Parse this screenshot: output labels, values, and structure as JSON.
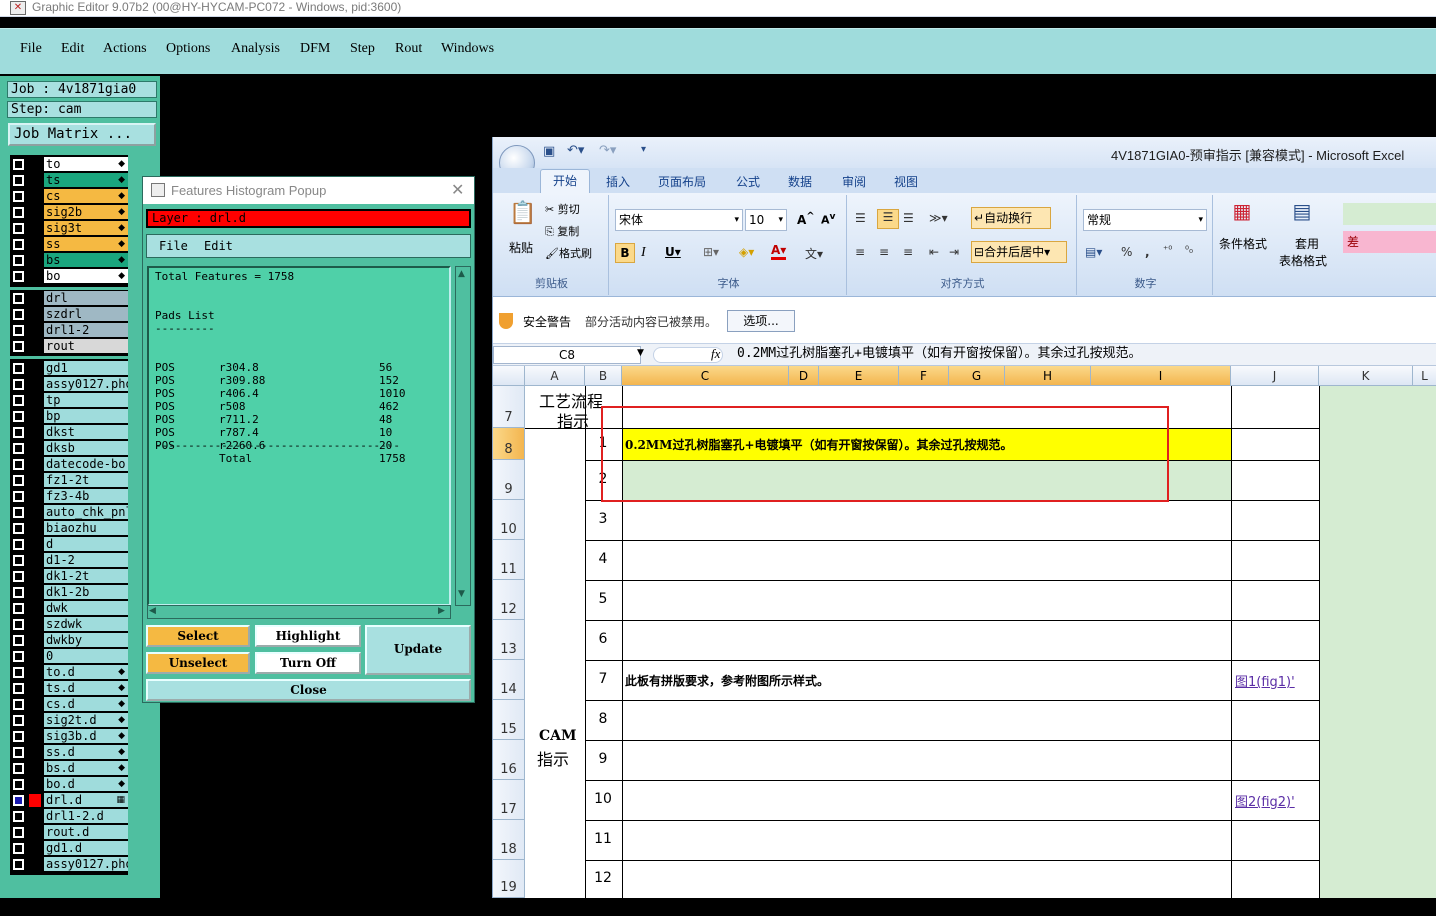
{
  "window": {
    "title": "Graphic Editor 9.07b2 (00@HY-HYCAM-PC072 - Windows, pid:3600)"
  },
  "menu": [
    {
      "label": "File"
    },
    {
      "label": "Edit"
    },
    {
      "label": "Actions"
    },
    {
      "label": "Options"
    },
    {
      "label": "Analysis"
    },
    {
      "label": "DFM"
    },
    {
      "label": "Step"
    },
    {
      "label": "Rout"
    },
    {
      "label": "Windows"
    }
  ],
  "job": {
    "job_label": "Job : 4v1871gia0",
    "step_label": "Step: cam",
    "matrix_button": "Job Matrix ..."
  },
  "layers": [
    {
      "name": "to",
      "color": "#ffffff",
      "mark": "◆"
    },
    {
      "name": "ts",
      "color": "#1aa67e",
      "mark": "◆"
    },
    {
      "name": "cs",
      "color": "#f5b942",
      "mark": "◆"
    },
    {
      "name": "sig2b",
      "color": "#f5b942",
      "mark": "◆"
    },
    {
      "name": "sig3t",
      "color": "#f5b942",
      "mark": "◆"
    },
    {
      "name": "ss",
      "color": "#f5b942",
      "mark": "◆"
    },
    {
      "name": "bs",
      "color": "#1aa67e",
      "mark": "◆"
    },
    {
      "name": "bo",
      "color": "#ffffff",
      "mark": "◆"
    },
    {
      "name": "drl",
      "color": "#9fb8c4",
      "mark": ""
    },
    {
      "name": "szdrl",
      "color": "#9fb8c4",
      "mark": ""
    },
    {
      "name": "drl1-2",
      "color": "#9fb8c4",
      "mark": ""
    },
    {
      "name": "rout",
      "color": "#d8d8d8",
      "mark": ""
    },
    {
      "name": "gd1",
      "color": "#9fdcdc",
      "mark": ""
    },
    {
      "name": "assy0127.pho",
      "color": "#9fdcdc",
      "mark": ""
    },
    {
      "name": "tp",
      "color": "#9fdcdc",
      "mark": ""
    },
    {
      "name": "bp",
      "color": "#9fdcdc",
      "mark": ""
    },
    {
      "name": "dkst",
      "color": "#9fdcdc",
      "mark": ""
    },
    {
      "name": "dksb",
      "color": "#9fdcdc",
      "mark": ""
    },
    {
      "name": "datecode-bo",
      "color": "#9fdcdc",
      "mark": ""
    },
    {
      "name": "fz1-2t",
      "color": "#9fdcdc",
      "mark": ""
    },
    {
      "name": "fz3-4b",
      "color": "#9fdcdc",
      "mark": ""
    },
    {
      "name": "auto_chk_pnl",
      "color": "#9fdcdc",
      "mark": ""
    },
    {
      "name": "biaozhu",
      "color": "#9fdcdc",
      "mark": ""
    },
    {
      "name": "d",
      "color": "#9fdcdc",
      "mark": ""
    },
    {
      "name": "d1-2",
      "color": "#9fdcdc",
      "mark": ""
    },
    {
      "name": "dk1-2t",
      "color": "#9fdcdc",
      "mark": ""
    },
    {
      "name": "dk1-2b",
      "color": "#9fdcdc",
      "mark": ""
    },
    {
      "name": "dwk",
      "color": "#9fdcdc",
      "mark": ""
    },
    {
      "name": "szdwk",
      "color": "#9fdcdc",
      "mark": ""
    },
    {
      "name": "dwkby",
      "color": "#9fdcdc",
      "mark": ""
    },
    {
      "name": "0",
      "color": "#9fdcdc",
      "mark": ""
    },
    {
      "name": "to.d",
      "color": "#9fdcdc",
      "mark": "◆"
    },
    {
      "name": "ts.d",
      "color": "#9fdcdc",
      "mark": "◆"
    },
    {
      "name": "cs.d",
      "color": "#9fdcdc",
      "mark": "◆"
    },
    {
      "name": "sig2t.d",
      "color": "#9fdcdc",
      "mark": "◆"
    },
    {
      "name": "sig3b.d",
      "color": "#9fdcdc",
      "mark": "◆"
    },
    {
      "name": "ss.d",
      "color": "#9fdcdc",
      "mark": "◆"
    },
    {
      "name": "bs.d",
      "color": "#9fdcdc",
      "mark": "◆"
    },
    {
      "name": "bo.d",
      "color": "#9fdcdc",
      "mark": "◆"
    },
    {
      "name": "drl.d",
      "color": "#9fdcdc",
      "mark": "▦"
    },
    {
      "name": "drl1-2.d",
      "color": "#9fdcdc",
      "mark": ""
    },
    {
      "name": "rout.d",
      "color": "#9fdcdc",
      "mark": ""
    },
    {
      "name": "gd1.d",
      "color": "#9fdcdc",
      "mark": ""
    },
    {
      "name": "assy0127.pho",
      "color": "#9fdcdc",
      "mark": ""
    }
  ],
  "popup": {
    "title": "Features Histogram Popup",
    "layer_label": "Layer :  drl.d",
    "menu_file": "File",
    "menu_edit": "Edit",
    "total_features": "Total Features = 1758",
    "pads_title": "Pads List",
    "pads_underline": "---------",
    "pads": [
      {
        "type": "POS",
        "sym": "r304.8",
        "count": "56"
      },
      {
        "type": "POS",
        "sym": "r309.88",
        "count": "152"
      },
      {
        "type": "POS",
        "sym": "r406.4",
        "count": "1010"
      },
      {
        "type": "POS",
        "sym": "r508",
        "count": "462"
      },
      {
        "type": "POS",
        "sym": "r711.2",
        "count": "48"
      },
      {
        "type": "POS",
        "sym": "r787.4",
        "count": "10"
      },
      {
        "type": "POS",
        "sym": "r2260.6",
        "count": "20"
      }
    ],
    "dash_line": "-------------------------------------",
    "total_label": "Total",
    "total_value": "1758",
    "buttons": {
      "select": "Select",
      "highlight": "Highlight",
      "update": "Update",
      "unselect": "Unselect",
      "turn_off": "Turn Off",
      "close": "Close"
    }
  },
  "excel": {
    "title": "4V1871GIA0-预审指示 [兼容模式] - Microsoft Excel",
    "tabs": [
      "开始",
      "插入",
      "页面布局",
      "公式",
      "数据",
      "审阅",
      "视图"
    ],
    "clipboard": {
      "paste": "粘贴",
      "cut": "剪切",
      "copy": "复制",
      "format_painter": "格式刷",
      "group": "剪贴板"
    },
    "font": {
      "name": "宋体",
      "size": "10",
      "group": "字体"
    },
    "align": {
      "wrap": "自动换行",
      "merge": "合并后居中",
      "group": "对齐方式"
    },
    "number": {
      "format": "常规",
      "group": "数字"
    },
    "styles": {
      "conditional": "条件格式",
      "table_line1": "套用",
      "table_line2": "表格格式",
      "bad": "差"
    },
    "security": {
      "label": "安全警告",
      "message": "部分活动内容已被禁用。",
      "options_button": "选项..."
    },
    "namebox": "C8",
    "fx": "fx",
    "formula": "0.2MM过孔树脂塞孔+电镀填平（如有开窗按保留）。其余过孔按规范。",
    "columns": [
      "A",
      "B",
      "C",
      "D",
      "E",
      "F",
      "G",
      "H",
      "I",
      "J",
      "K",
      "L"
    ],
    "row_numbers": [
      "7",
      "8",
      "9",
      "10",
      "11",
      "12",
      "13",
      "14",
      "15",
      "16",
      "17",
      "18",
      "19"
    ],
    "section_a_line1": "工艺流程",
    "section_a_line2": "指示",
    "section_b_line1": "CAM",
    "section_b_line2": "指示",
    "items": [
      {
        "num": "1",
        "text": "0.2MM过孔树脂塞孔+电镀填平（如有开窗按保留）。其余过孔按规范。",
        "link": ""
      },
      {
        "num": "2",
        "text": "",
        "link": ""
      },
      {
        "num": "3",
        "text": "",
        "link": ""
      },
      {
        "num": "4",
        "text": "",
        "link": ""
      },
      {
        "num": "5",
        "text": "",
        "link": ""
      },
      {
        "num": "6",
        "text": "",
        "link": ""
      },
      {
        "num": "7",
        "text": "此板有拼版要求，参考附图所示样式。",
        "link": "图1(fig1)'"
      },
      {
        "num": "8",
        "text": "",
        "link": ""
      },
      {
        "num": "9",
        "text": "",
        "link": ""
      },
      {
        "num": "10",
        "text": "",
        "link": "图2(fig2)'"
      },
      {
        "num": "11",
        "text": "",
        "link": ""
      },
      {
        "num": "12",
        "text": "",
        "link": ""
      }
    ]
  }
}
